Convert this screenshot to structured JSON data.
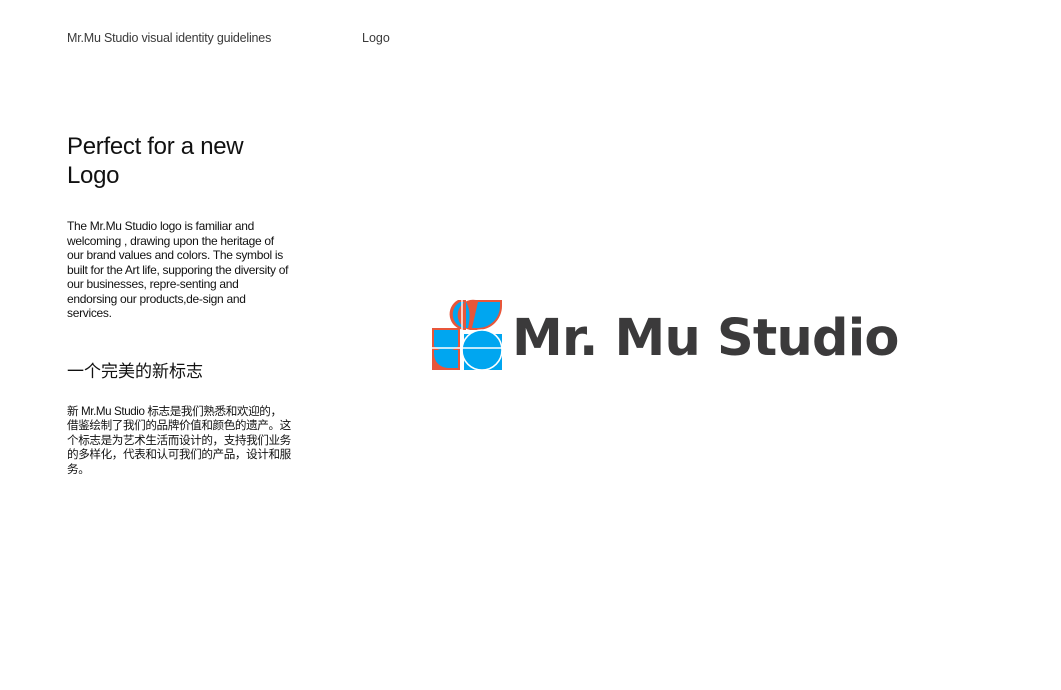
{
  "header": {
    "doc_title": "Mr.Mu Studio visual identity guidelines",
    "section": "Logo"
  },
  "intro": {
    "heading_en": "Perfect  for a new Logo",
    "body_en": "The Mr.Mu Studio logo is familiar and welcoming , drawing upon the heritage of our brand values and colors. The symbol is built for the Art life, supporing the diversity of our businesses, repre-senting and endorsing our products,de-sign and services.",
    "heading_cn": "一个完美的新标志",
    "body_cn": "新 Mr.Mu Studio 标志是我们熟悉和欢迎的，借鉴绘制了我们的品牌价值和颜色的遗产。这个标志是为艺术生活而设计的，支持我们业务的多样化，代表和认可我们的产品，设计和服务。"
  },
  "logo": {
    "wordmark": "Mr. Mu Studio",
    "colors": {
      "blue": "#00a6f0",
      "orange_outline": "#e8563a",
      "wordmark": "#3b3a3b"
    }
  }
}
